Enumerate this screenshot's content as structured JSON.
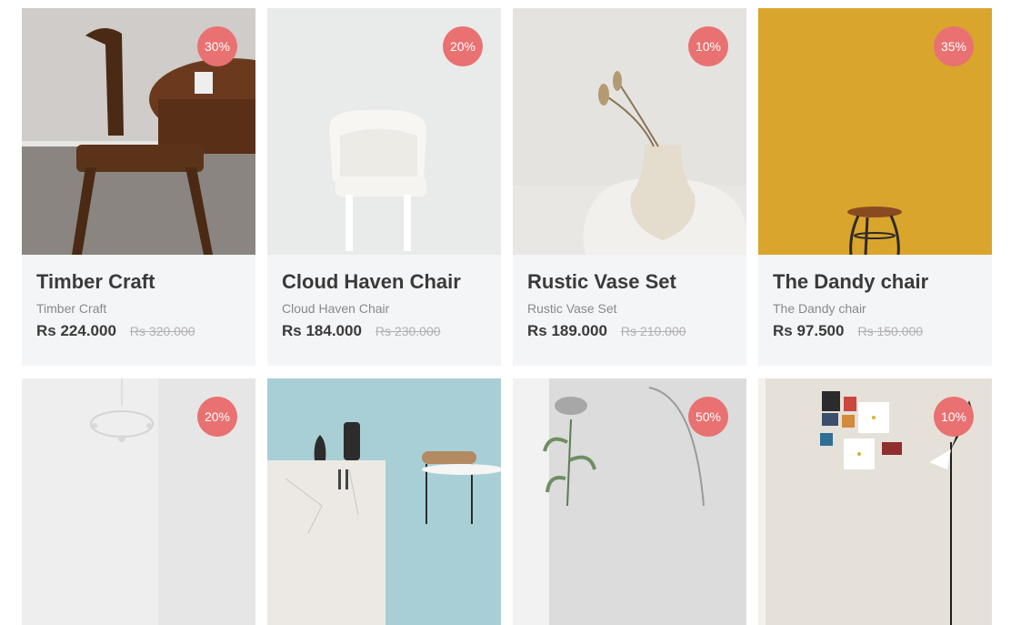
{
  "products": [
    {
      "title": "Timber Craft",
      "subtitle": "Timber Craft",
      "price": "Rs 224.000",
      "old_price": "Rs 320.000",
      "discount": "30%"
    },
    {
      "title": "Cloud Haven Chair",
      "subtitle": "Cloud Haven Chair",
      "price": "Rs 184.000",
      "old_price": "Rs 230.000",
      "discount": "20%"
    },
    {
      "title": "Rustic Vase Set",
      "subtitle": "Rustic Vase Set",
      "price": "Rs 189.000",
      "old_price": "Rs 210.000",
      "discount": "10%"
    },
    {
      "title": "The Dandy chair",
      "subtitle": "The Dandy chair",
      "price": "Rs 97.500",
      "old_price": "Rs 150.000",
      "discount": "35%"
    },
    {
      "discount": "20%"
    },
    {
      "discount": ""
    },
    {
      "discount": "50%"
    },
    {
      "discount": "10%"
    }
  ],
  "colors": {
    "badge": "#e97171",
    "card_bg": "#f4f5f7",
    "title": "#3a3a3a"
  }
}
